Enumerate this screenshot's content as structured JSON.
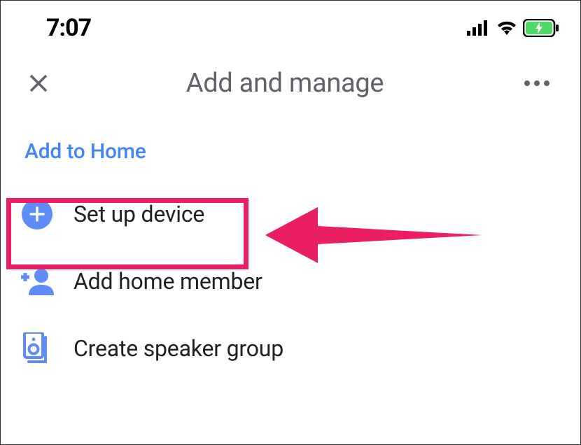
{
  "status": {
    "time": "7:07"
  },
  "header": {
    "title": "Add and manage"
  },
  "section": {
    "title": "Add to Home"
  },
  "menu": {
    "setup_device": "Set up device",
    "add_member": "Add home member",
    "speaker_group": "Create speaker group"
  }
}
